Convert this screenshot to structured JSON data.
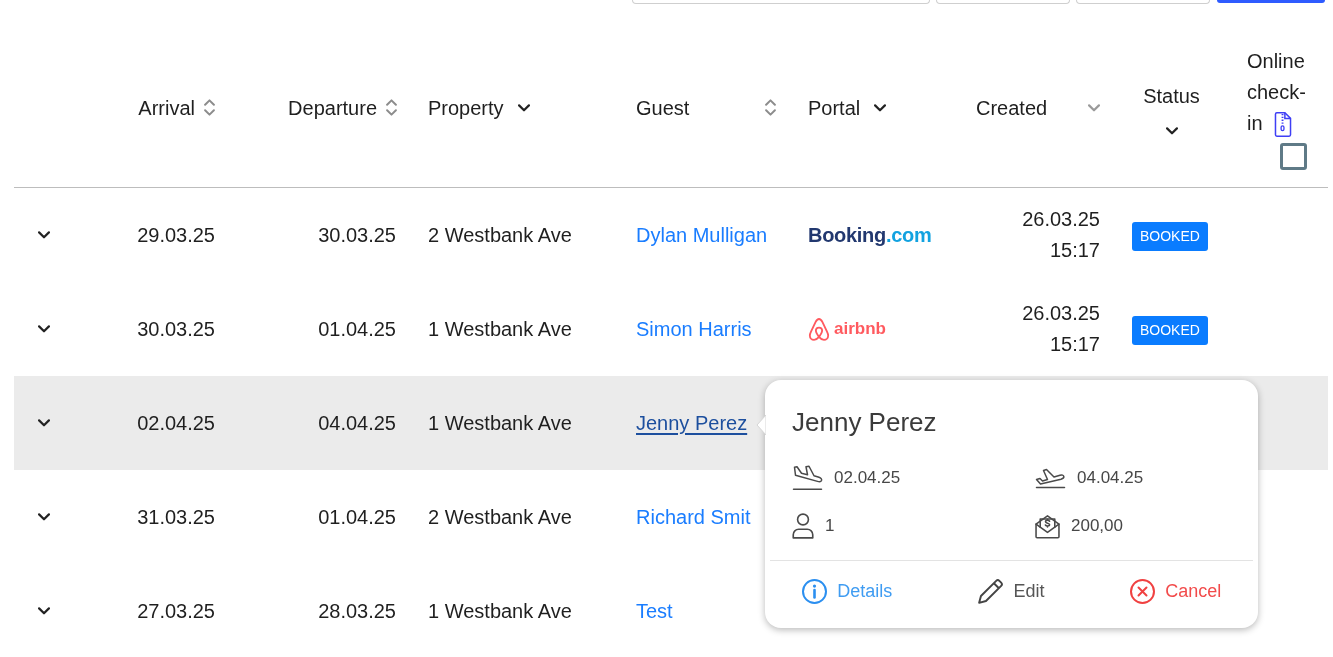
{
  "toolbar": [
    {
      "kind": "field"
    },
    {
      "kind": "select"
    },
    {
      "kind": "select"
    },
    {
      "kind": "button"
    }
  ],
  "table": {
    "columns": [
      {
        "label": "Arrival",
        "kind": "sort"
      },
      {
        "label": "Departure",
        "kind": "sort"
      },
      {
        "label": "Property",
        "kind": "filter"
      },
      {
        "label": "Guest",
        "kind": "sort"
      },
      {
        "label": "Portal",
        "kind": "filter"
      },
      {
        "label": "Created",
        "kind": "sort_desc"
      },
      {
        "label": "Status",
        "kind": "filter"
      },
      {
        "label": "Online check-in",
        "kind": "checkbox",
        "checked": false
      }
    ],
    "rows": [
      {
        "expanded": false,
        "highlighted": false,
        "arrival": "29.03.25",
        "departure": "30.03.25",
        "property": "2 Westbank Ave",
        "guest": "Dylan Mulligan",
        "portal": {
          "kind": "booking",
          "name": "Booking",
          "suffix": ".com"
        },
        "created_date": "26.03.25",
        "created_time": "15:17",
        "status": "BOOKED"
      },
      {
        "expanded": false,
        "highlighted": false,
        "arrival": "30.03.25",
        "departure": "01.04.25",
        "property": "1 Westbank Ave",
        "guest": "Simon Harris",
        "portal": {
          "kind": "airbnb",
          "name": "airbnb"
        },
        "created_date": "26.03.25",
        "created_time": "15:17",
        "status": "BOOKED"
      },
      {
        "expanded": false,
        "highlighted": true,
        "arrival": "02.04.25",
        "departure": "04.04.25",
        "property": "1 Westbank Ave",
        "guest": "Jenny Perez"
      },
      {
        "expanded": false,
        "highlighted": false,
        "arrival": "31.03.25",
        "departure": "01.04.25",
        "property": "2 Westbank Ave",
        "guest": "Richard Smit"
      },
      {
        "expanded": false,
        "highlighted": false,
        "arrival": "27.03.25",
        "departure": "28.03.25",
        "property": "1 Westbank Ave",
        "guest": "Test"
      }
    ]
  },
  "popover": {
    "title": "Jenny Perez",
    "fields": [
      {
        "kind": "arrival",
        "value": "02.04.25"
      },
      {
        "kind": "departure",
        "value": "04.04.25"
      },
      {
        "kind": "guests",
        "value": "1"
      },
      {
        "kind": "price",
        "value": "200,00"
      }
    ],
    "actions": [
      {
        "kind": "details",
        "label": "Details"
      },
      {
        "kind": "edit",
        "label": "Edit"
      },
      {
        "kind": "cancel",
        "label": "Cancel"
      }
    ]
  }
}
